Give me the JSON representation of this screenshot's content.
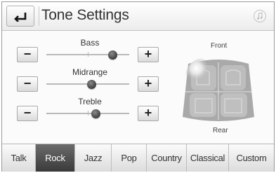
{
  "header": {
    "title": "Tone Settings",
    "back_icon": "back-arrow-icon",
    "media_icon": "music-note-icon"
  },
  "controls": [
    {
      "name": "Bass",
      "level": 0.8,
      "decrease_label": "−",
      "increase_label": "+"
    },
    {
      "name": "Midrange",
      "level": 0.55,
      "decrease_label": "−",
      "increase_label": "+"
    },
    {
      "name": "Treble",
      "level": 0.6,
      "decrease_label": "−",
      "increase_label": "+"
    }
  ],
  "balance": {
    "front_label": "Front",
    "rear_label": "Rear"
  },
  "tabs": [
    {
      "label": "Talk",
      "active": false
    },
    {
      "label": "Rock",
      "active": true
    },
    {
      "label": "Jazz",
      "active": false
    },
    {
      "label": "Pop",
      "active": false
    },
    {
      "label": "Country",
      "active": false
    },
    {
      "label": "Classical",
      "active": false
    },
    {
      "label": "Custom",
      "active": false
    }
  ],
  "colors": {
    "active_tab": "#4a4a4a",
    "knob": "#555555"
  }
}
